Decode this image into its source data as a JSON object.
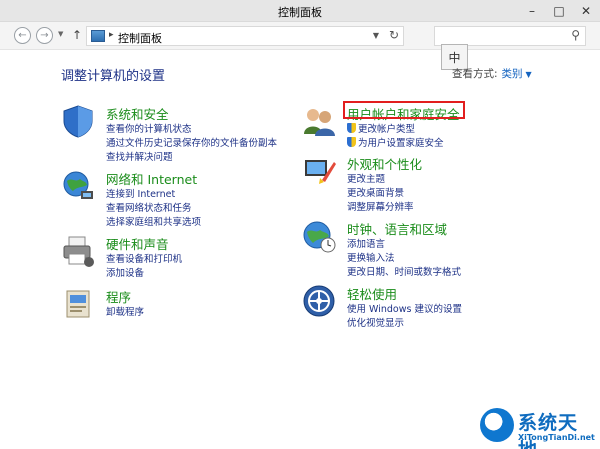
{
  "window": {
    "title": "控制面板"
  },
  "address": {
    "crumb": "控制面板",
    "search_placeholder": ""
  },
  "ime": {
    "label": "中"
  },
  "main": {
    "heading": "调整计算机的设置",
    "view_by": {
      "label": "查看方式:",
      "value": "类别"
    }
  },
  "categories": [
    {
      "title": "系统和安全",
      "links": [
        "查看你的计算机状态",
        "通过文件历史记录保存你的文件备份副本",
        "查找并解决问题"
      ]
    },
    {
      "title": "网络和 Internet",
      "links": [
        "连接到 Internet",
        "查看网络状态和任务",
        "选择家庭组和共享选项"
      ]
    },
    {
      "title": "硬件和声音",
      "links": [
        "查看设备和打印机",
        "添加设备"
      ]
    },
    {
      "title": "程序",
      "links": [
        "卸载程序"
      ]
    },
    {
      "title": "用户帐户和家庭安全",
      "links": [
        "更改帐户类型",
        "为用户设置家庭安全"
      ]
    },
    {
      "title": "外观和个性化",
      "links": [
        "更改主题",
        "更改桌面背景",
        "调整屏幕分辨率"
      ]
    },
    {
      "title": "时钟、语言和区域",
      "links": [
        "添加语言",
        "更换输入法",
        "更改日期、时间或数字格式"
      ]
    },
    {
      "title": "轻松使用",
      "links": [
        "使用 Windows 建议的设置",
        "优化视觉显示"
      ]
    }
  ],
  "watermark": {
    "text": "系统天地",
    "sub": "XiTongTianDi.net"
  },
  "colors": {
    "category_title": "#1a8c1a",
    "link": "#1e3287",
    "highlight_border": "#e21e1e"
  }
}
